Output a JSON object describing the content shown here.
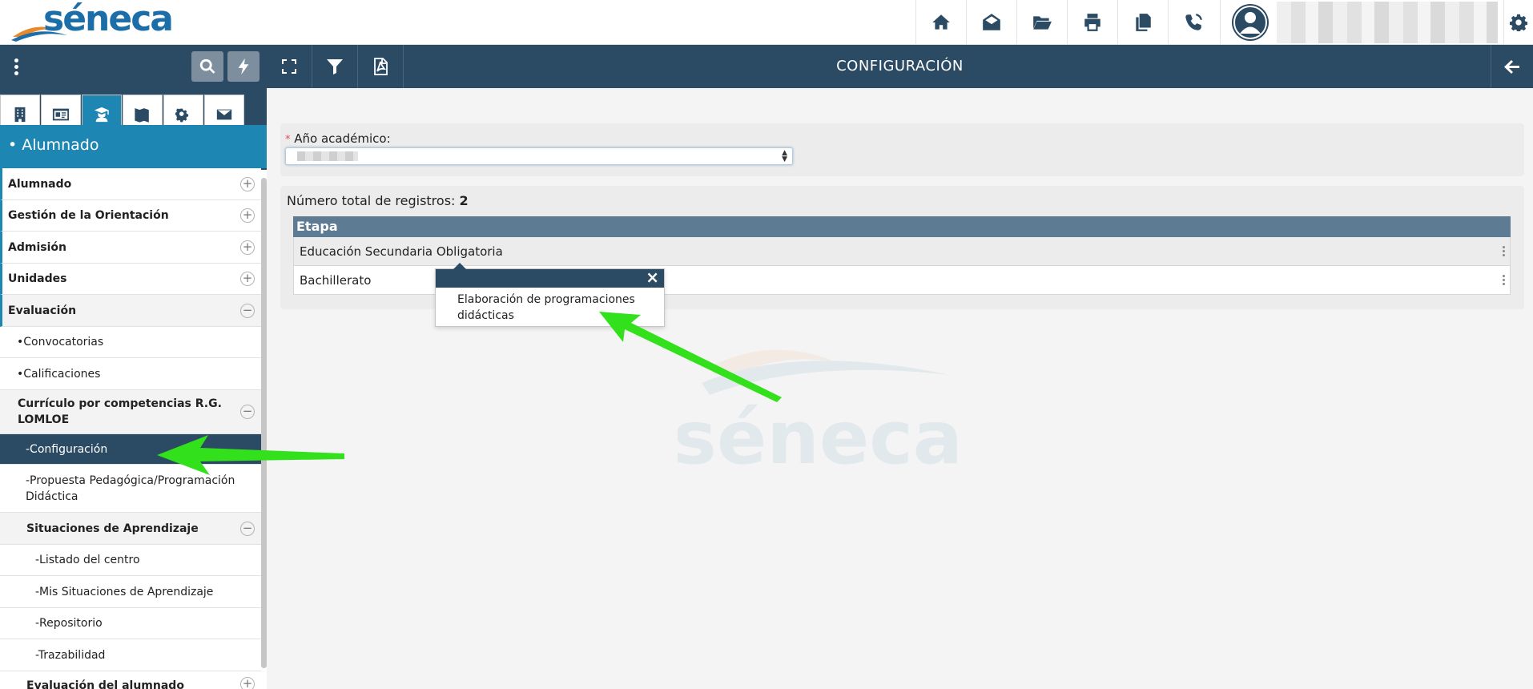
{
  "app": {
    "logo_text": "séneca"
  },
  "topbar": {
    "icons": [
      "home-icon",
      "envelope-icon",
      "folder-icon",
      "print-icon",
      "copy-icon",
      "phone-icon"
    ],
    "settings_icon": "gear-icon"
  },
  "sidebar": {
    "heading": "• Alumnado",
    "tabs": [
      "building-icon",
      "id-card-icon",
      "students-icon",
      "map-icon",
      "cogs-icon",
      "envelope-icon"
    ],
    "active_tab": 2,
    "items": [
      {
        "label": "Alumnado",
        "expand": "+"
      },
      {
        "label": "Gestión de la Orientación",
        "expand": "+"
      },
      {
        "label": "Admisión",
        "expand": "+"
      },
      {
        "label": "Unidades",
        "expand": "+"
      },
      {
        "label": "Evaluación",
        "expand": "−"
      },
      {
        "label": "•Convocatorias"
      },
      {
        "label": "•Calificaciones"
      },
      {
        "label": "Currículo por competencias R.G. LOMLOE",
        "expand": "−"
      },
      {
        "label": "-Configuración"
      },
      {
        "label": "-Propuesta Pedagógica/Programación Didáctica"
      },
      {
        "label": "Situaciones de Aprendizaje",
        "expand": "−"
      },
      {
        "label": "-Listado del centro"
      },
      {
        "label": "-Mis Situaciones de Aprendizaje"
      },
      {
        "label": "-Repositorio"
      },
      {
        "label": "-Trazabilidad"
      },
      {
        "label": "Evaluación del alumnado",
        "expand": "+"
      }
    ]
  },
  "content": {
    "title": "CONFIGURACIÓN",
    "year_label": "Año académico:",
    "required_mark": "*",
    "count_label": "Número total de registros:",
    "count_value": "2",
    "table": {
      "header": "Etapa",
      "rows": [
        "Educación Secundaria Obligatoria",
        "Bachillerato"
      ]
    },
    "popover": {
      "close": "×",
      "item": "Elaboración de programaciones didácticas"
    }
  },
  "colors": {
    "navy": "#2b4a63",
    "accent_blue": "#1e86b3",
    "table_header": "#5d7c93",
    "annotation_green": "#33e01c"
  }
}
